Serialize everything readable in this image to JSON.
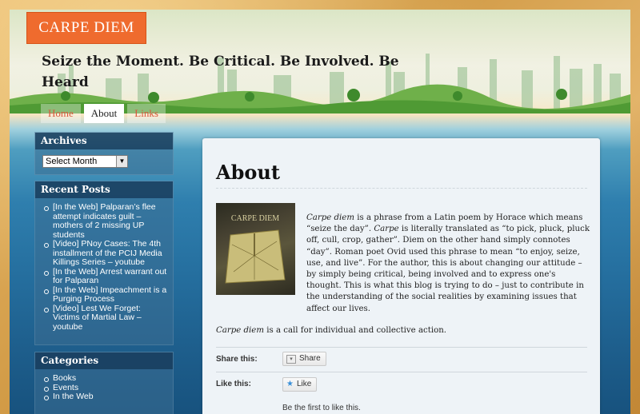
{
  "site": {
    "brand": "CARPE DIEM",
    "tagline": "Seize the Moment. Be Critical. Be Involved. Be Heard"
  },
  "nav": [
    {
      "label": "Home",
      "active": false
    },
    {
      "label": "About",
      "active": true
    },
    {
      "label": "Links",
      "active": false
    }
  ],
  "sidebar": {
    "archives": {
      "title": "Archives",
      "select_value": "Select Month"
    },
    "recent_posts": {
      "title": "Recent Posts",
      "items": [
        "[In the Web] Palparan’s flee attempt indicates guilt – mothers of 2 missing UP students",
        "[Video] PNoy Cases: The 4th installment of the PCIJ Media Killings Series – youtube",
        "[In the Web] Arrest warrant out for Palparan",
        "[In the Web] Impeachment is a Purging Process",
        "[Video] Lest We Forget: Victims of Martial Law – youtube"
      ]
    },
    "categories": {
      "title": "Categories",
      "items": [
        "Books",
        "Events",
        "In the Web"
      ]
    }
  },
  "page": {
    "title": "About",
    "image_caption": "CARPE DIEM",
    "para1_em": "Carpe diem",
    "para1_a": " is a phrase from a Latin poem by Horace which means “seize the day”. ",
    "para1_em2": "Carpe",
    "para1_b": " is literally translated as “to pick, pluck, pluck off, cull, crop, gather”. Diem on the other hand simply connotes “day”. Roman poet Ovid used this phrase to mean “to enjoy, seize, use, and live”. For the author, this is about changing our attitude – by simply being critical, being involved and to express one's thought. This is what this blog is trying to do – just to contribute in the understanding of the social realities by examining issues that affect our lives.",
    "para2_em": "Carpe diem",
    "para2_rest": " is a call for individual and collective action.",
    "share_label": "Share this:",
    "share_button": "Share",
    "like_label": "Like this:",
    "like_button": "Like",
    "first_like": "Be the first to like this."
  }
}
